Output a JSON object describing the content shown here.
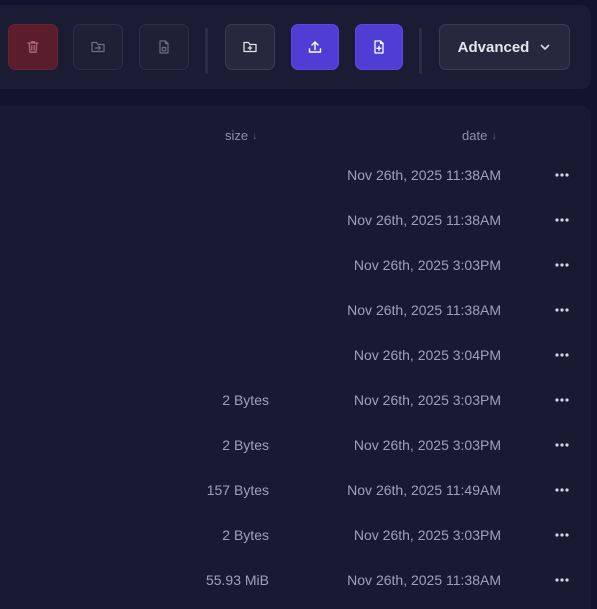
{
  "toolbar": {
    "buttons": [
      {
        "name": "delete-button",
        "icon": "trash-icon",
        "state": "danger-disabled"
      },
      {
        "name": "move-button",
        "icon": "folder-move-icon",
        "state": "disabled"
      },
      {
        "name": "copy-button",
        "icon": "file-copy-icon",
        "state": "disabled"
      },
      {
        "name": "new-folder-button",
        "icon": "folder-plus-icon",
        "state": "enabled"
      },
      {
        "name": "upload-button",
        "icon": "upload-icon",
        "state": "primary"
      },
      {
        "name": "new-file-button",
        "icon": "file-plus-icon",
        "state": "primary"
      }
    ],
    "advanced_label": "Advanced"
  },
  "columns": {
    "size_label": "size",
    "date_label": "date",
    "sort_indicator": "↓"
  },
  "rows": [
    {
      "size": "",
      "date": "Nov 26th, 2025 11:38AM"
    },
    {
      "size": "",
      "date": "Nov 26th, 2025 11:38AM"
    },
    {
      "size": "",
      "date": "Nov 26th, 2025 3:03PM"
    },
    {
      "size": "",
      "date": "Nov 26th, 2025 11:38AM"
    },
    {
      "size": "",
      "date": "Nov 26th, 2025 3:04PM"
    },
    {
      "size": "2 Bytes",
      "date": "Nov 26th, 2025 3:03PM"
    },
    {
      "size": "2 Bytes",
      "date": "Nov 26th, 2025 3:03PM"
    },
    {
      "size": "157 Bytes",
      "date": "Nov 26th, 2025 11:49AM"
    },
    {
      "size": "2 Bytes",
      "date": "Nov 26th, 2025 3:03PM"
    },
    {
      "size": "55.93 MiB",
      "date": "Nov 26th, 2025 11:38AM"
    }
  ],
  "colors": {
    "background": "#13142b",
    "panel": "#1a1c33",
    "primary": "#4f3ed4",
    "danger": "#5a1d2b"
  }
}
